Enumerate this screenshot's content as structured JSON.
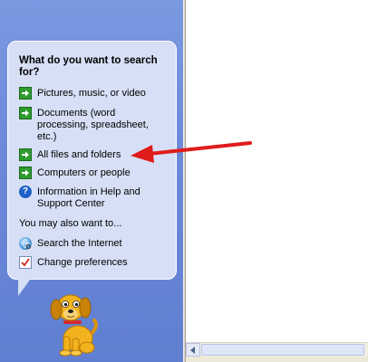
{
  "search_companion": {
    "question": "What do you want to search for?",
    "options": [
      {
        "label": "Pictures, music, or video",
        "icon": "green-arrow-icon"
      },
      {
        "label": "Documents (word processing, spreadsheet, etc.)",
        "icon": "green-arrow-icon"
      },
      {
        "label": "All files and folders",
        "icon": "green-arrow-icon"
      },
      {
        "label": "Computers or people",
        "icon": "green-arrow-icon"
      },
      {
        "label": "Information in Help and Support Center",
        "icon": "help-icon"
      }
    ],
    "also_heading": "You may also want to...",
    "also_options": [
      {
        "label": "Search the Internet",
        "icon": "globe-search-icon"
      },
      {
        "label": "Change preferences",
        "icon": "preferences-icon"
      }
    ]
  },
  "colors": {
    "pane_blue": "#6c8ada",
    "bubble_fill": "#d6dff5",
    "annotation_red": "#e01b1b",
    "arrow_green": "#2e9b2e"
  }
}
